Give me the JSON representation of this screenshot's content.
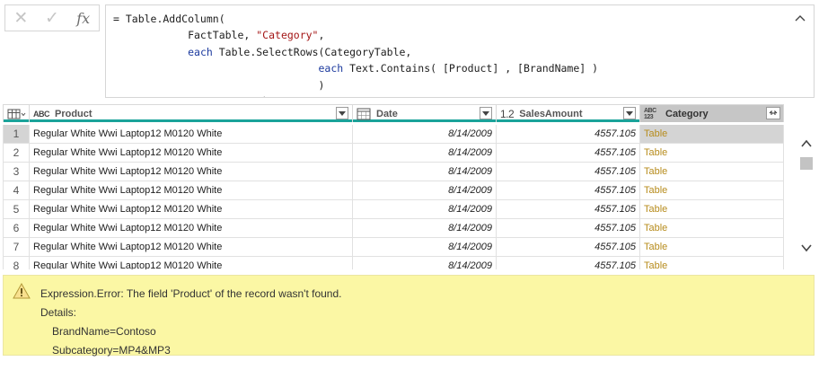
{
  "formula_bar": {
    "cancel_icon": "close-icon",
    "commit_icon": "check-icon",
    "fx_label": "fx",
    "lines": [
      {
        "parts": [
          {
            "t": "= Table.AddColumn(",
            "c": "plain"
          }
        ]
      },
      {
        "parts": [
          {
            "t": "            FactTable, ",
            "c": "plain"
          },
          {
            "t": "\"Category\"",
            "c": "str"
          },
          {
            "t": ",",
            "c": "plain"
          }
        ]
      },
      {
        "parts": [
          {
            "t": "            ",
            "c": "plain"
          },
          {
            "t": "each",
            "c": "kw"
          },
          {
            "t": " Table.SelectRows(CategoryTable,",
            "c": "plain"
          }
        ]
      },
      {
        "parts": [
          {
            "t": "                                 ",
            "c": "plain"
          },
          {
            "t": "each",
            "c": "kw"
          },
          {
            "t": " Text.Contains( [Product] , [BrandName] )",
            "c": "plain"
          }
        ]
      },
      {
        "parts": [
          {
            "t": "                                 )",
            "c": "plain"
          }
        ]
      },
      {
        "parts": [
          {
            "t": "                        `",
            "c": "plain"
          }
        ]
      }
    ]
  },
  "table": {
    "columns": [
      {
        "label": "Product",
        "type_icon": "ABC",
        "name": "column-product"
      },
      {
        "label": "Date",
        "type_icon": "calendar-icon",
        "name": "column-date"
      },
      {
        "label": "SalesAmount",
        "type_icon": "1.2",
        "name": "column-salesamount"
      },
      {
        "label": "Category",
        "type_icon": "ABC\n123",
        "name": "column-category"
      }
    ],
    "rows": [
      {
        "index": "1",
        "product": "Regular White Wwi Laptop12 M0120 White",
        "date": "8/14/2009",
        "sales": "4557.105",
        "category": "Table"
      },
      {
        "index": "2",
        "product": "Regular White Wwi Laptop12 M0120 White",
        "date": "8/14/2009",
        "sales": "4557.105",
        "category": "Table"
      },
      {
        "index": "3",
        "product": "Regular White Wwi Laptop12 M0120 White",
        "date": "8/14/2009",
        "sales": "4557.105",
        "category": "Table"
      },
      {
        "index": "4",
        "product": "Regular White Wwi Laptop12 M0120 White",
        "date": "8/14/2009",
        "sales": "4557.105",
        "category": "Table"
      },
      {
        "index": "5",
        "product": "Regular White Wwi Laptop12 M0120 White",
        "date": "8/14/2009",
        "sales": "4557.105",
        "category": "Table"
      },
      {
        "index": "6",
        "product": "Regular White Wwi Laptop12 M0120 White",
        "date": "8/14/2009",
        "sales": "4557.105",
        "category": "Table"
      },
      {
        "index": "7",
        "product": "Regular White Wwi Laptop12 M0120 White",
        "date": "8/14/2009",
        "sales": "4557.105",
        "category": "Table"
      },
      {
        "index": "8",
        "product": "Regular White Wwi Laptop12 M0120 White",
        "date": "8/14/2009",
        "sales": "4557.105",
        "category": "Table"
      }
    ]
  },
  "error": {
    "icon": "warning-icon",
    "message": "Expression.Error: The field 'Product' of the record wasn't found.",
    "details_label": "Details:",
    "details": [
      "BrandName=Contoso",
      "Subcategory=MP4&MP3"
    ]
  },
  "colors": {
    "accent_teal": "#1aa39a",
    "error_bg": "#fbf7a4",
    "category_text": "#b78c1d",
    "keyword": "#1c3a9e",
    "string": "#a31515"
  }
}
